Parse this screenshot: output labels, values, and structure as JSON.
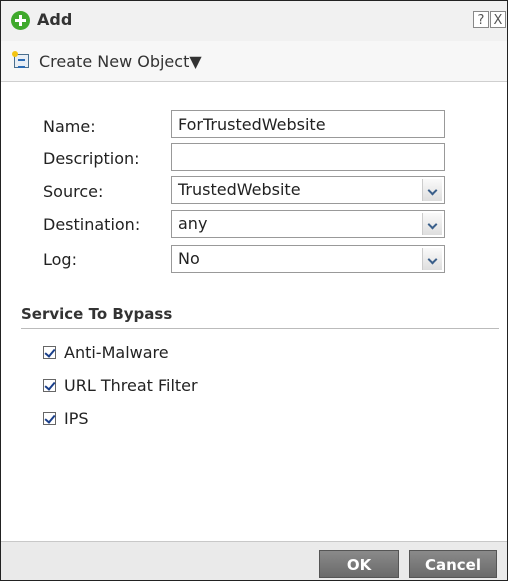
{
  "dialog": {
    "title": "Add",
    "help_label": "?",
    "close_label": "X"
  },
  "toolbar": {
    "create_label": "Create New Object▼"
  },
  "form": {
    "name": {
      "label": "Name:",
      "value": "ForTrustedWebsite"
    },
    "description": {
      "label": "Description:",
      "value": ""
    },
    "source": {
      "label": "Source:",
      "value": "TrustedWebsite"
    },
    "destination": {
      "label": "Destination:",
      "value": "any"
    },
    "log": {
      "label": "Log:",
      "value": "No"
    }
  },
  "bypass": {
    "title": "Service To Bypass",
    "items": [
      {
        "label": "Anti-Malware",
        "checked": true
      },
      {
        "label": "URL Threat Filter",
        "checked": true
      },
      {
        "label": "IPS",
        "checked": true
      }
    ]
  },
  "footer": {
    "ok_label": "OK",
    "cancel_label": "Cancel"
  },
  "icons": {
    "add": "add-circle-icon",
    "create_object": "object-icon",
    "checkbox": "check-icon"
  },
  "colors": {
    "add_icon": "#3fa92b",
    "button_bg": "#777777",
    "titlebar_bg": "#f1f1f1"
  }
}
